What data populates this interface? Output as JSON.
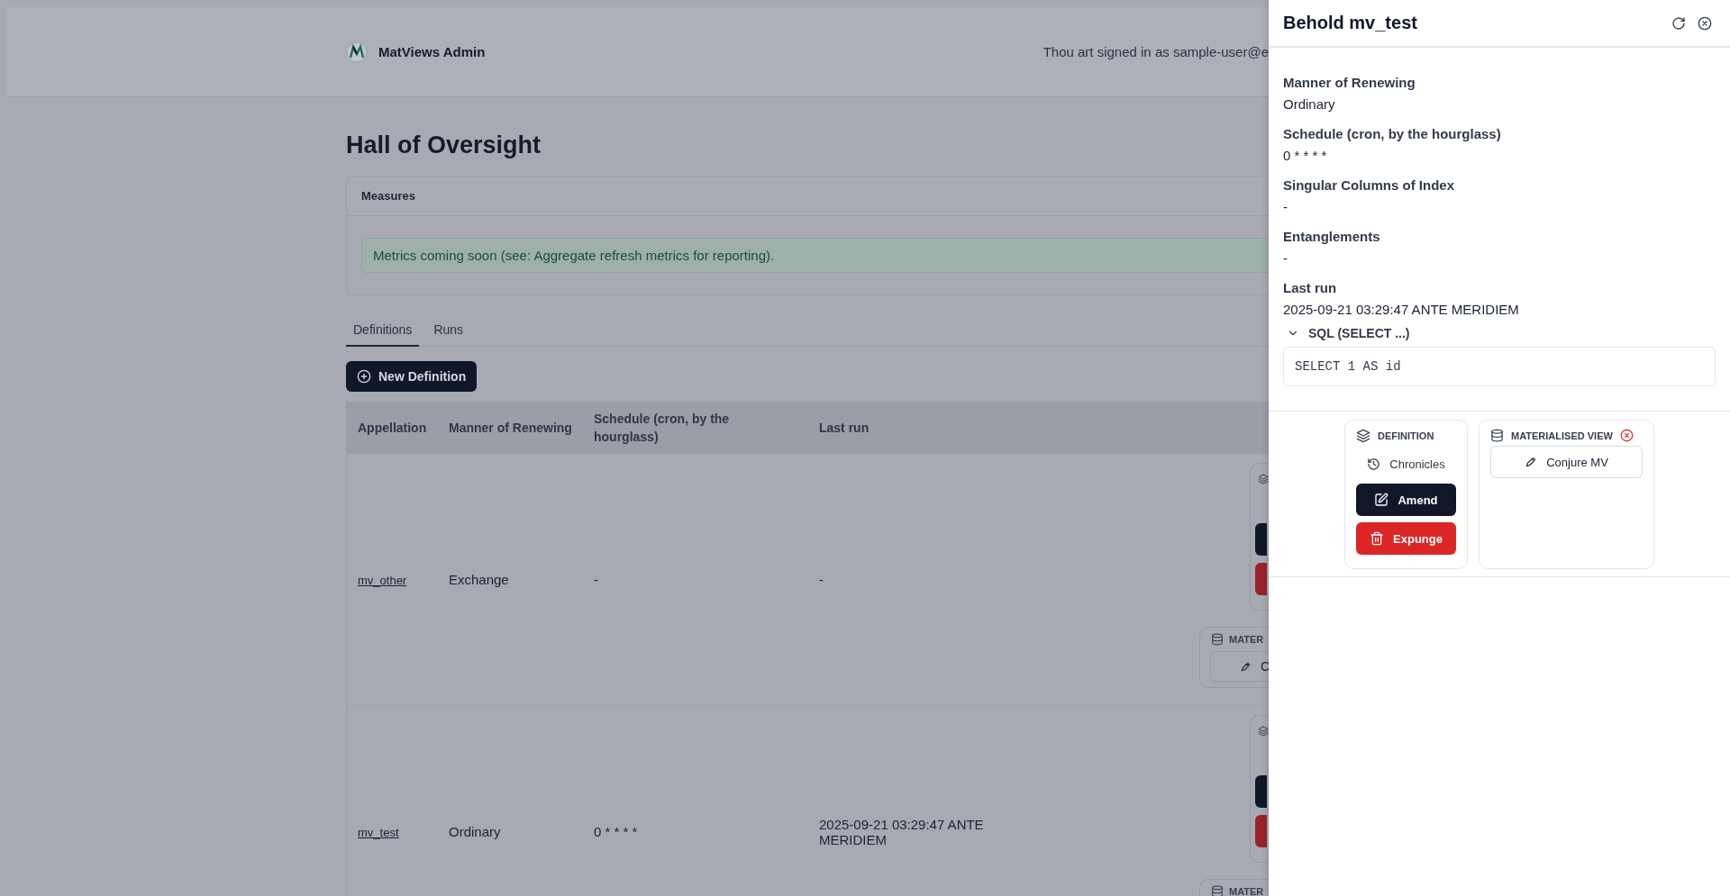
{
  "header": {
    "brand": "MatViews Admin",
    "signed_in": "Thou art signed in as sample-user@e"
  },
  "page_title": "Hall of Oversight",
  "measures": {
    "title": "Measures",
    "alert": "Metrics coming soon (see: Aggregate refresh metrics for reporting)."
  },
  "tabs": [
    {
      "label": "Definitions",
      "selected": true
    },
    {
      "label": "Runs",
      "selected": false
    }
  ],
  "new_button": "New Definition",
  "table": {
    "columns": [
      "Appellation",
      "Manner of Renewing",
      "Schedule (cron, by the hourglass)",
      "Last run"
    ],
    "rows": [
      {
        "appellation": "mv_other",
        "manner": "Exchange",
        "schedule": "-",
        "last_run": "-",
        "mv_label": "MATER",
        "mv_button": "C"
      },
      {
        "appellation": "mv_test",
        "manner": "Ordinary",
        "schedule": "0 * * * *",
        "last_run": "2025-09-21 03:29:47 ANTE MERIDIEM",
        "mv_label": "MATER"
      }
    ]
  },
  "drawer": {
    "title": "Behold mv_test",
    "fields": [
      {
        "label": "Manner of Renewing",
        "value": "Ordinary"
      },
      {
        "label": "Schedule (cron, by the hourglass)",
        "value": "0 * * * *"
      },
      {
        "label": "Singular Columns of Index",
        "value": "-"
      },
      {
        "label": "Entanglements",
        "value": "-"
      },
      {
        "label": "Last run",
        "value": "2025-09-21 03:29:47 ANTE MERIDIEM"
      }
    ],
    "sql": {
      "label": "SQL (SELECT ...)",
      "expanded": true,
      "code": "SELECT 1 AS id"
    },
    "definition_card": {
      "title": "DEFINITION",
      "link": "Chronicles",
      "buttons": [
        {
          "label": "Amend",
          "kind": "primary"
        },
        {
          "label": "Expunge",
          "kind": "danger"
        }
      ]
    },
    "mv_card": {
      "title": "MATERIALISED VIEW",
      "error": true,
      "button": "Conjure MV"
    }
  }
}
